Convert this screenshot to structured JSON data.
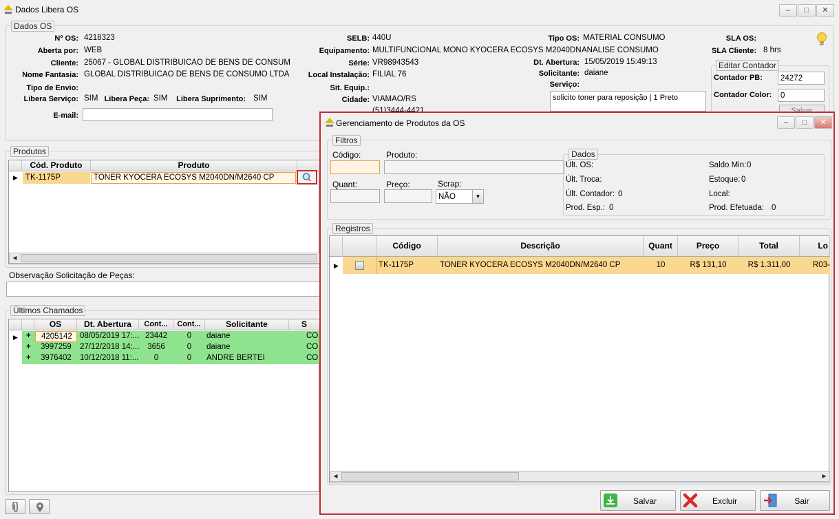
{
  "window": {
    "title": "Dados Libera OS"
  },
  "dados_os": {
    "legend": "Dados OS",
    "n_os_label": "Nº OS:",
    "n_os": "4218323",
    "aberta_por_label": "Aberta por:",
    "aberta_por": "WEB",
    "cliente_label": "Cliente:",
    "cliente": "25067 - GLOBAL DISTRIBUICAO DE BENS DE CONSUM",
    "nome_fantasia_label": "Nome Fantasia:",
    "nome_fantasia": "GLOBAL DISTRIBUICAO DE BENS DE CONSUMO LTDA",
    "tipo_envio_label": "Tipo de Envio:",
    "libera_servico_label": "Libera Serviço:",
    "libera_servico": "SIM",
    "libera_peca_label": "Libera Peça:",
    "libera_peca": "SIM",
    "libera_suprimento_label": "Libera Suprimento:",
    "libera_suprimento": "SIM",
    "email_label": "E-mail:",
    "email": "",
    "selb_label": "SELB:",
    "selb": "440U",
    "equipamento_label": "Equipamento:",
    "equipamento": "MULTIFUNCIONAL MONO KYOCERA ECOSYS M2040DN",
    "serie_label": "Série:",
    "serie": "VR98943543",
    "local_instalacao_label": "Local Instalação:",
    "local_instalacao": "FILIAL 76",
    "sit_equip_label": "Sit. Equip.:",
    "sit_equip": "",
    "cidade_label": "Cidade:",
    "cidade": "VIAMAO/RS",
    "telefone_partial": "(51)3444-4421",
    "tipo_os_label": "Tipo OS:",
    "tipo_os": "MATERIAL CONSUMO",
    "tipo_os_sub": "ANALISE CONSUMO",
    "dt_abertura_label": "Dt. Abertura:",
    "dt_abertura": "15/05/2019 15:49:13",
    "solicitante_label": "Solicitante:",
    "solicitante": "daiane",
    "servico_label": "Serviço:",
    "servico": "solicito toner para reposição | 1 Preto",
    "sla_os_label": "SLA OS:",
    "sla_os": "",
    "sla_cliente_label": "SLA Cliente:",
    "sla_cliente": "8 hrs",
    "editar_contador": {
      "legend": "Editar Contador",
      "contador_pb_label": "Contador PB:",
      "contador_pb": "24272",
      "contador_color_label": "Contador Color:",
      "contador_color": "0",
      "salvar_label": "Salvar"
    }
  },
  "produtos": {
    "legend": "Produtos",
    "columns": [
      "Cód. Produto",
      "Produto"
    ],
    "rows": [
      {
        "codigo": "TK-1175P",
        "produto": "TONER KYOCERA ECOSYS M2040DN/M2640 CP"
      }
    ]
  },
  "observacao": {
    "label": "Observação Solicitação de Peças:",
    "value": ""
  },
  "ultimos_chamados": {
    "legend": "Últimos Chamados",
    "columns": [
      "OS",
      "Dt. Abertura",
      "Cont...",
      "Cont...",
      "Solicitante",
      "S"
    ],
    "rows": [
      {
        "expand": "+",
        "os": "4205142",
        "dt": "08/05/2019 17:...",
        "cont1": "23442",
        "cont2": "0",
        "solicitante": "daiane",
        "s": "CO"
      },
      {
        "expand": "+",
        "os": "3997259",
        "dt": "27/12/2018 14:...",
        "cont1": "3656",
        "cont2": "0",
        "solicitante": "daiane",
        "s": "CO"
      },
      {
        "expand": "+",
        "os": "3976402",
        "dt": "10/12/2018 11:...",
        "cont1": "0",
        "cont2": "0",
        "solicitante": "ANDRE BERTEI",
        "s": "CO"
      }
    ]
  },
  "modal": {
    "title": "Gerenciamento de Produtos da OS",
    "filtros": {
      "legend": "Filtros",
      "codigo_label": "Código:",
      "codigo": "",
      "produto_label": "Produto:",
      "produto": "",
      "quant_label": "Quant:",
      "quant": "",
      "preco_label": "Preço:",
      "preco": "",
      "scrap_label": "Scrap:",
      "scrap": "NÃO"
    },
    "dados": {
      "legend": "Dados",
      "ult_os_label": "Últ. OS:",
      "ult_os": "",
      "ult_troca_label": "Últ. Troca:",
      "ult_troca": "",
      "ult_contador_label": "Últ. Contador:",
      "ult_contador": "0",
      "prod_esp_label": "Prod. Esp.:",
      "prod_esp": "0",
      "saldo_min_label": "Saldo Min:",
      "saldo_min": "0",
      "estoque_label": "Estoque:",
      "estoque": "0",
      "local_label": "Local:",
      "local": "",
      "prod_efetuada_label": "Prod. Efetuada:",
      "prod_efetuada": "0"
    },
    "registros": {
      "legend": "Registros",
      "columns": [
        "Código",
        "Descrição",
        "Quant",
        "Preço",
        "Total",
        "Lo"
      ],
      "rows": [
        {
          "codigo": "TK-1175P",
          "descricao": "TONER KYOCERA ECOSYS M2040DN/M2640 CP",
          "quant": "10",
          "preco": "R$ 131,10",
          "total": "R$ 1.311,00",
          "local": "R03-"
        }
      ]
    },
    "buttons": {
      "salvar": "Salvar",
      "excluir": "Excluir",
      "sair": "Sair"
    }
  }
}
